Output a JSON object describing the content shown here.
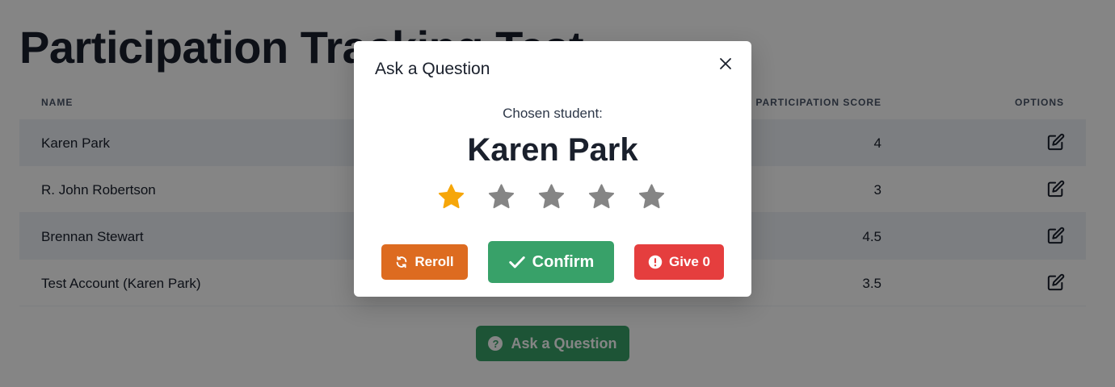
{
  "page": {
    "title": "Participation Tracking Test"
  },
  "table": {
    "headers": {
      "name": "NAME",
      "score": "PARTICIPATION SCORE",
      "options": "OPTIONS"
    },
    "rows": [
      {
        "name": "Karen Park",
        "score": "4"
      },
      {
        "name": "R. John Robertson",
        "score": "3"
      },
      {
        "name": "Brennan Stewart",
        "score": "4.5"
      },
      {
        "name": "Test Account (Karen Park)",
        "score": "3.5"
      }
    ],
    "row_icon": "edit-icon"
  },
  "ask_button": {
    "label": "Ask a Question",
    "icon": "question-circle-icon"
  },
  "modal": {
    "title": "Ask a Question",
    "close_icon": "close-icon",
    "chosen_label": "Chosen student:",
    "chosen_name": "Karen Park",
    "rating": {
      "value": 1,
      "max": 5
    },
    "buttons": {
      "reroll": "Reroll",
      "confirm": "Confirm",
      "give0": "Give 0"
    }
  },
  "colors": {
    "star_active": "#f6a609",
    "star_inactive": "#858585",
    "reroll": "#dd6b20",
    "confirm": "#38a169",
    "give0": "#e53e3e"
  }
}
